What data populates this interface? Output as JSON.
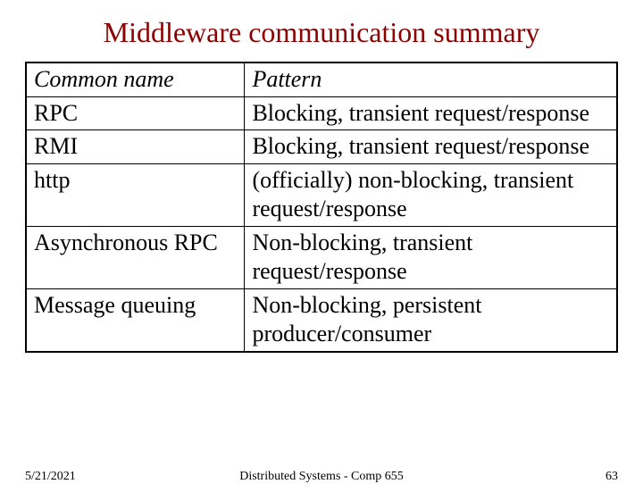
{
  "title": "Middleware communication summary",
  "table": {
    "header": {
      "col1": "Common name",
      "col2": "Pattern"
    },
    "rows": [
      {
        "name": "RPC",
        "pattern": "Blocking, transient request/response"
      },
      {
        "name": "RMI",
        "pattern": "Blocking, transient request/response"
      },
      {
        "name": "http",
        "pattern": "(officially) non-blocking, transient request/response"
      },
      {
        "name": "Asynchronous RPC",
        "pattern": "Non-blocking, transient request/response"
      },
      {
        "name": "Message queuing",
        "pattern": "Non-blocking, persistent producer/consumer"
      }
    ]
  },
  "footer": {
    "date": "5/21/2021",
    "center": "Distributed Systems - Comp 655",
    "page": "63"
  }
}
